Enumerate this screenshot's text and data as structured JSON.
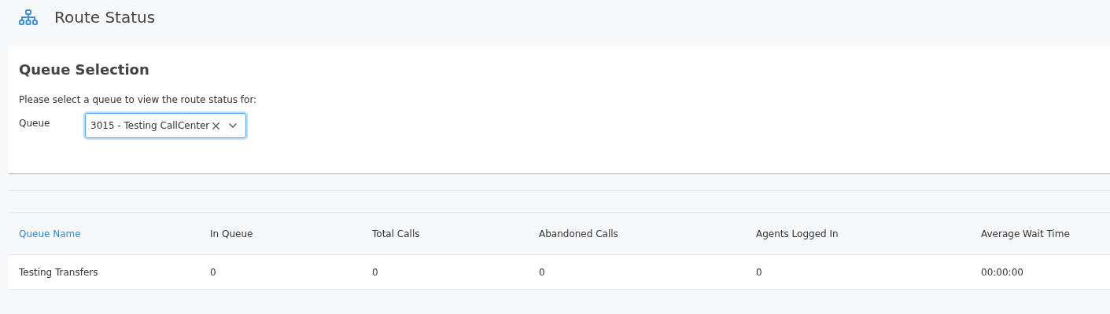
{
  "page": {
    "title": "Route Status"
  },
  "selection": {
    "heading": "Queue Selection",
    "prompt": "Please select a queue to view the route status for:",
    "field_label": "Queue",
    "value": "3015 - Testing CallCenter"
  },
  "table": {
    "columns": [
      {
        "label": "Queue Name",
        "active": true
      },
      {
        "label": "In Queue",
        "active": false
      },
      {
        "label": "Total Calls",
        "active": false
      },
      {
        "label": "Abandoned Calls",
        "active": false
      },
      {
        "label": "Agents Logged In",
        "active": false
      },
      {
        "label": "Average Wait Time",
        "active": false
      }
    ],
    "rows": [
      [
        "Testing Transfers",
        "0",
        "0",
        "0",
        "0",
        "00:00:00"
      ]
    ]
  }
}
